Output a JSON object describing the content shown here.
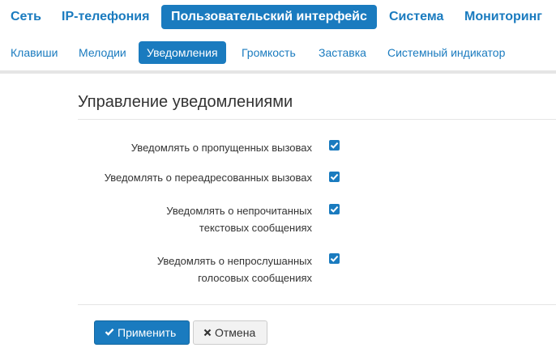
{
  "top_nav": {
    "items": [
      {
        "label": "Сеть"
      },
      {
        "label": "IP-телефония"
      },
      {
        "label": "Пользовательский интерфейс",
        "active": true
      },
      {
        "label": "Система"
      },
      {
        "label": "Мониторинг"
      }
    ]
  },
  "sub_nav": {
    "items": [
      {
        "label": "Клавиши"
      },
      {
        "label": "Мелодии"
      },
      {
        "label": "Уведомления",
        "active": true
      },
      {
        "label": "Громкость"
      },
      {
        "label": "Заставка"
      },
      {
        "label": "Системный индикатор"
      }
    ]
  },
  "section": {
    "title": "Управление уведомлениями"
  },
  "options": [
    {
      "label": "Уведомлять о пропущенных вызовах",
      "checked": true
    },
    {
      "label": "Уведомлять о переадресованных вызовах",
      "checked": true
    },
    {
      "label": "Уведомлять о непрочитанных текстовых сообщениях",
      "checked": true
    },
    {
      "label": "Уведомлять о непрослушанных голосовых сообщениях",
      "checked": true
    }
  ],
  "buttons": {
    "apply_label": "Применить",
    "cancel_label": "Отмена"
  },
  "colors": {
    "accent": "#1a7bbf",
    "divider": "#e5e5e5"
  },
  "icons": {
    "apply": "check-icon",
    "cancel": "close-icon"
  }
}
